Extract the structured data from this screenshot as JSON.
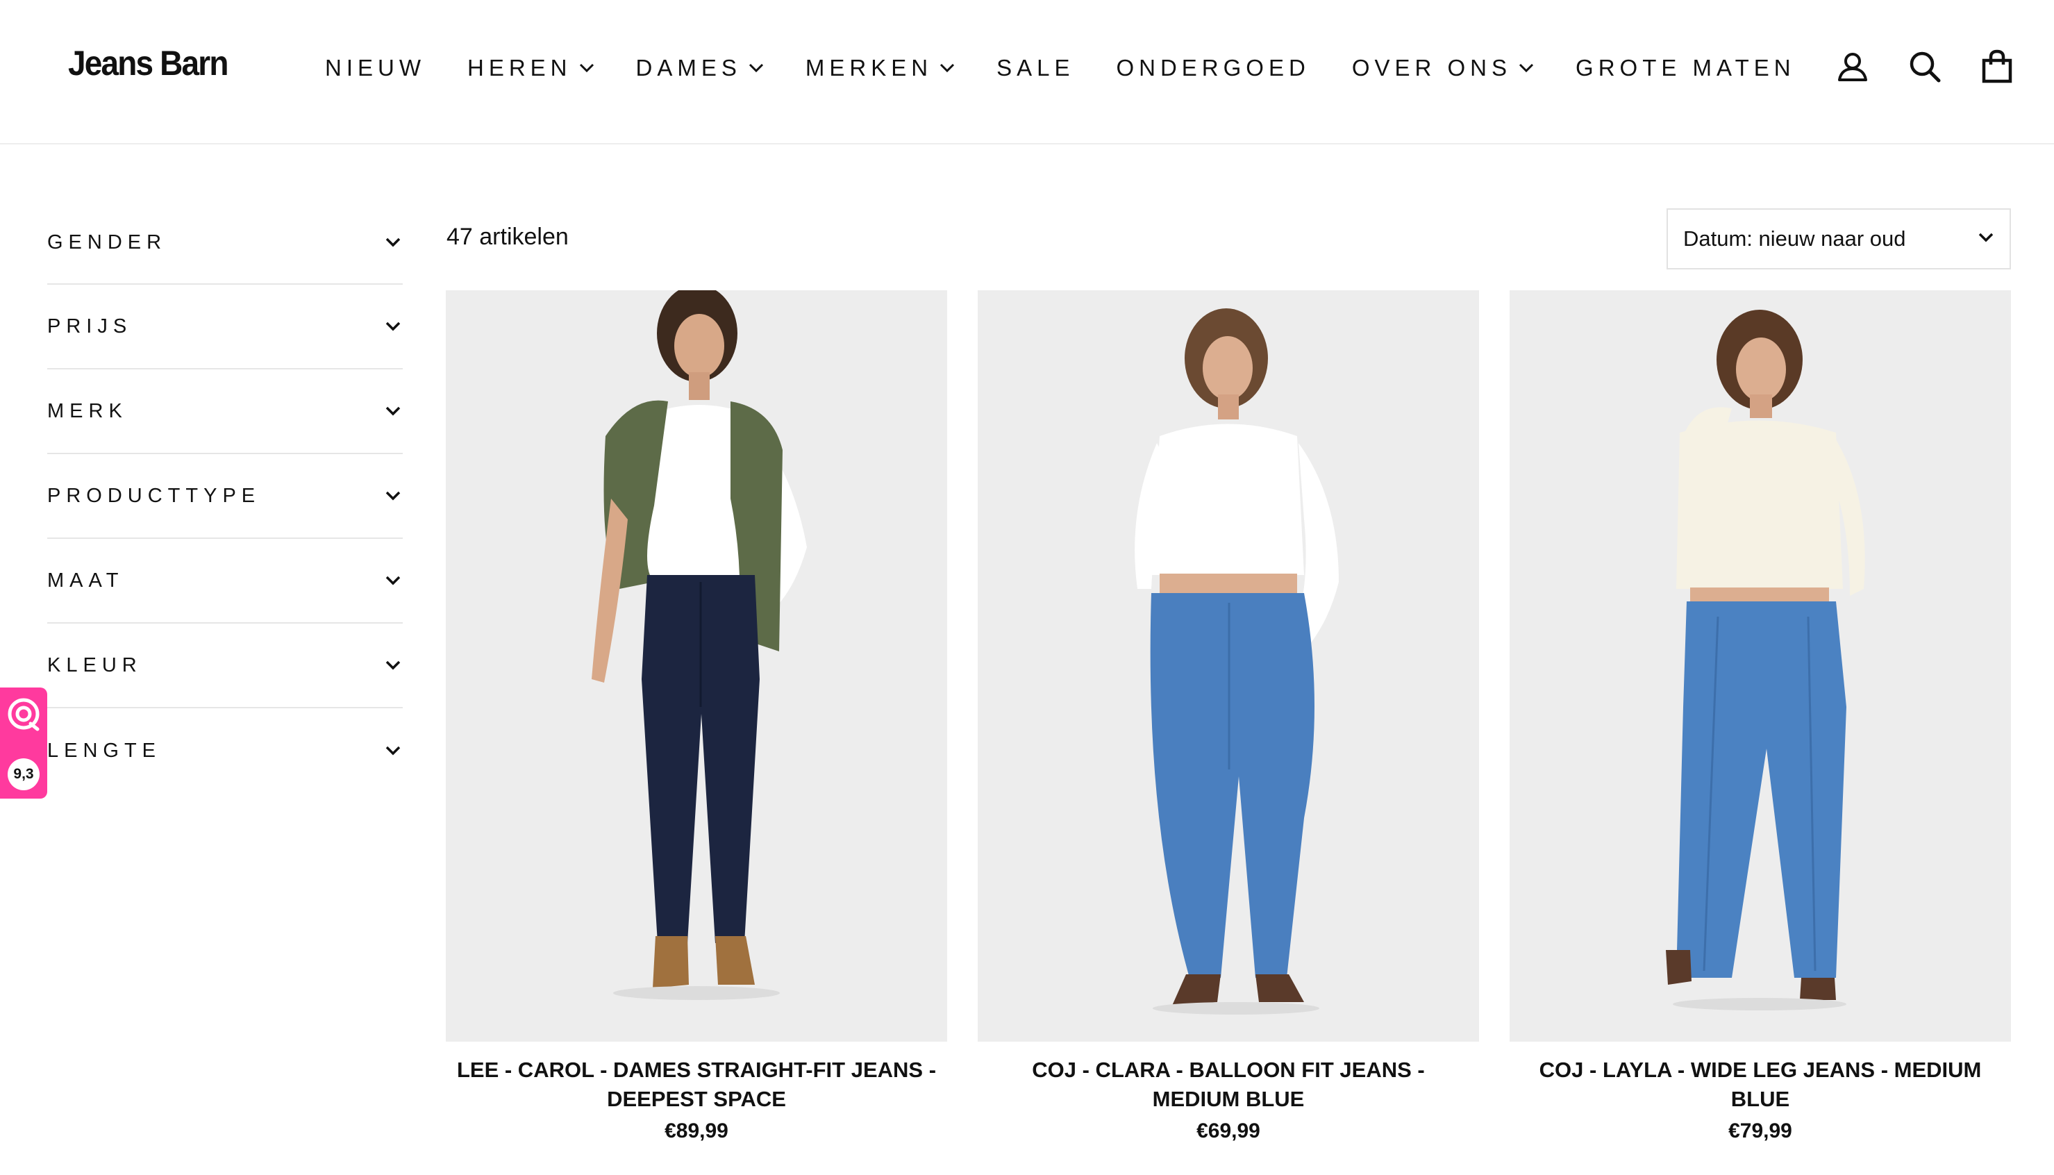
{
  "header": {
    "logo": "Jeans Barn",
    "nav": [
      {
        "label": "NIEUW",
        "dropdown": false
      },
      {
        "label": "HEREN",
        "dropdown": true
      },
      {
        "label": "DAMES",
        "dropdown": true
      },
      {
        "label": "MERKEN",
        "dropdown": true
      },
      {
        "label": "SALE",
        "dropdown": false
      },
      {
        "label": "ONDERGOED",
        "dropdown": false
      },
      {
        "label": "OVER ONS",
        "dropdown": true
      },
      {
        "label": "GROTE MATEN",
        "dropdown": false
      }
    ],
    "icons": [
      "account-icon",
      "search-icon",
      "cart-icon"
    ]
  },
  "filters": [
    {
      "label": "GENDER"
    },
    {
      "label": "PRIJS"
    },
    {
      "label": "MERK"
    },
    {
      "label": "PRODUCTTYPE"
    },
    {
      "label": "MAAT"
    },
    {
      "label": "KLEUR"
    },
    {
      "label": "LENGTE"
    }
  ],
  "review_badge": {
    "score": "9,3",
    "color": "#ff3a9e"
  },
  "listing": {
    "count": "47 artikelen",
    "sort_selected": "Datum: nieuw naar oud"
  },
  "products": [
    {
      "title": "LEE - CAROL - DAMES STRAIGHT-FIT JEANS - DEEPEST SPACE",
      "price": "€89,99",
      "jeans_color": "#1c2540",
      "top_color": "#ffffff",
      "extra_color": "#5d6b48",
      "shoe_color": "#a0713e"
    },
    {
      "title": "COJ - CLARA - BALLOON FIT JEANS - MEDIUM BLUE",
      "price": "€69,99",
      "jeans_color": "#4a7fbf",
      "top_color": "#ffffff",
      "shoe_color": "#5a3a2a"
    },
    {
      "title": "COJ - LAYLA - WIDE LEG JEANS - MEDIUM BLUE",
      "price": "€79,99",
      "jeans_color": "#4b82c2",
      "top_color": "#f6f2e4",
      "shoe_color": "#5a3a2a"
    }
  ]
}
